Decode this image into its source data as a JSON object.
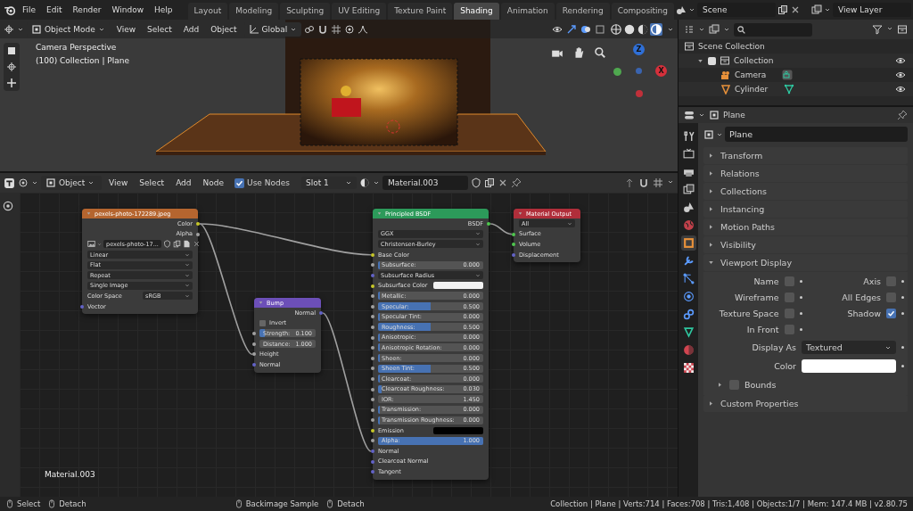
{
  "topbar": {
    "menus": [
      "File",
      "Edit",
      "Render",
      "Window",
      "Help"
    ],
    "workspaces": [
      {
        "label": "Layout",
        "selected": false
      },
      {
        "label": "Modeling",
        "selected": false
      },
      {
        "label": "Sculpting",
        "selected": false
      },
      {
        "label": "UV Editing",
        "selected": false
      },
      {
        "label": "Texture Paint",
        "selected": false
      },
      {
        "label": "Shading",
        "selected": true
      },
      {
        "label": "Animation",
        "selected": false
      },
      {
        "label": "Rendering",
        "selected": false
      },
      {
        "label": "Compositing",
        "selected": false
      }
    ],
    "scene": "Scene",
    "view_layer": "View Layer"
  },
  "viewport": {
    "mode": "Object Mode",
    "menus": [
      "View",
      "Select",
      "Add",
      "Object"
    ],
    "orientation": "Global",
    "shading": [
      {
        "kind": "wireframe",
        "selected": false
      },
      {
        "kind": "solid",
        "selected": false
      },
      {
        "kind": "material",
        "selected": false
      },
      {
        "kind": "rendered",
        "selected": true
      }
    ],
    "overlay": [
      "Camera Perspective",
      "(100) Collection | Plane"
    ],
    "axes": [
      {
        "label": "Z",
        "color": "#2f6fd6"
      },
      {
        "label": "X",
        "color": "#d6303b"
      }
    ]
  },
  "node_editor": {
    "type": "Object",
    "menus": [
      "View",
      "Select",
      "Add",
      "Node"
    ],
    "use_nodes": {
      "label": "Use Nodes",
      "checked": true
    },
    "slot": "Slot 1",
    "material": "Material.003",
    "nodes": [
      {
        "title": "pexels-photo-172289.jpeg",
        "color": "#b5652f",
        "rows": [
          {
            "kind": "output",
            "label": "Color",
            "color": "#c7c729",
            "linked": true
          },
          {
            "kind": "output",
            "label": "Alpha",
            "color": "#a1a1a1"
          },
          {
            "kind": "image",
            "value": "pexels-photo-17..."
          },
          {
            "kind": "dropdown",
            "value": "Linear"
          },
          {
            "kind": "dropdown",
            "value": "Flat"
          },
          {
            "kind": "dropdown",
            "value": "Repeat"
          },
          {
            "kind": "dropdown",
            "value": "Single Image"
          },
          {
            "kind": "labeled_dropdown",
            "label": "Color Space",
            "value": "sRGB"
          },
          {
            "kind": "input",
            "label": "Vector",
            "color": "#6363c7"
          }
        ]
      },
      {
        "title": "Bump",
        "color": "#6c4fb8",
        "rows": [
          {
            "kind": "output",
            "label": "Normal",
            "color": "#6363c7",
            "linked": true
          },
          {
            "kind": "checkbox",
            "label": "Invert",
            "checked": false
          },
          {
            "kind": "slider",
            "label": "Strength:",
            "value": "0.100",
            "level": 0.1,
            "color": "#a1a1a1"
          },
          {
            "kind": "number",
            "label": "Distance:",
            "value": "1.000",
            "color": "#a1a1a1"
          },
          {
            "kind": "input",
            "label": "Height",
            "color": "#a1a1a1",
            "linked": true
          },
          {
            "kind": "input",
            "label": "Normal",
            "color": "#6363c7"
          }
        ]
      },
      {
        "title": "Principled BSDF",
        "color": "#2c9a5a",
        "rows": [
          {
            "kind": "output",
            "label": "BSDF",
            "color": "#4fc74f",
            "linked": true
          },
          {
            "kind": "dropdown",
            "value": "GGX"
          },
          {
            "kind": "dropdown",
            "value": "Christensen-Burley"
          },
          {
            "kind": "input",
            "label": "Base Color",
            "color": "#c7c729",
            "linked": true
          },
          {
            "kind": "slider",
            "label": "Subsurface:",
            "value": "0.000",
            "level": 0,
            "color": "#a1a1a1"
          },
          {
            "kind": "dropdown",
            "value": "Subsurface Radius",
            "color": "#6363c7"
          },
          {
            "kind": "swatch",
            "label": "Subsurface Color",
            "color": "#f2f2f2",
            "socket": {
              "color": "#c7c729"
            }
          },
          {
            "kind": "slider",
            "label": "Metallic:",
            "value": "0.000",
            "level": 0,
            "color": "#a1a1a1"
          },
          {
            "kind": "slider",
            "label": "Specular:",
            "value": "0.500",
            "level": 0.5,
            "color": "#a1a1a1"
          },
          {
            "kind": "slider",
            "label": "Specular Tint:",
            "value": "0.000",
            "level": 0,
            "color": "#a1a1a1"
          },
          {
            "kind": "slider",
            "label": "Roughness:",
            "value": "0.500",
            "level": 0.5,
            "color": "#a1a1a1"
          },
          {
            "kind": "slider",
            "label": "Anisotropic:",
            "value": "0.000",
            "level": 0,
            "color": "#a1a1a1"
          },
          {
            "kind": "slider",
            "label": "Anisotropic Rotation:",
            "value": "0.000",
            "level": 0,
            "color": "#a1a1a1"
          },
          {
            "kind": "slider",
            "label": "Sheen:",
            "value": "0.000",
            "level": 0,
            "color": "#a1a1a1"
          },
          {
            "kind": "slider",
            "label": "Sheen Tint:",
            "value": "0.500",
            "level": 0.5,
            "color": "#a1a1a1"
          },
          {
            "kind": "slider",
            "label": "Clearcoat:",
            "value": "0.000",
            "level": 0,
            "color": "#a1a1a1"
          },
          {
            "kind": "slider",
            "label": "Clearcoat Roughness:",
            "value": "0.030",
            "level": 0.03,
            "color": "#a1a1a1"
          },
          {
            "kind": "number",
            "label": "IOR:",
            "value": "1.450",
            "color": "#a1a1a1"
          },
          {
            "kind": "slider",
            "label": "Transmission:",
            "value": "0.000",
            "level": 0,
            "color": "#a1a1a1"
          },
          {
            "kind": "slider",
            "label": "Transmission Roughness:",
            "value": "0.000",
            "level": 0,
            "color": "#a1a1a1"
          },
          {
            "kind": "swatch",
            "label": "Emission",
            "color": "#000000",
            "socket": {
              "color": "#c7c729"
            }
          },
          {
            "kind": "slider",
            "label": "Alpha:",
            "value": "1.000",
            "level": 1,
            "color": "#a1a1a1"
          },
          {
            "kind": "input",
            "label": "Normal",
            "color": "#6363c7",
            "linked": true
          },
          {
            "kind": "input",
            "label": "Clearcoat Normal",
            "color": "#6363c7"
          },
          {
            "kind": "input",
            "label": "Tangent",
            "color": "#6363c7"
          }
        ]
      },
      {
        "title": "Material Output",
        "color": "#b02e3a",
        "rows": [
          {
            "kind": "dropdown",
            "value": "All"
          },
          {
            "kind": "input",
            "label": "Surface",
            "color": "#4fc74f",
            "linked": true
          },
          {
            "kind": "input",
            "label": "Volume",
            "color": "#4fc74f"
          },
          {
            "kind": "input",
            "label": "Displacement",
            "color": "#6363c7"
          }
        ]
      }
    ],
    "material_label": "Material.003"
  },
  "outliner": {
    "items": [
      {
        "kind": "scene_collection",
        "label": "Scene Collection",
        "children": [
          {
            "kind": "collection",
            "label": "Collection",
            "checked": true,
            "expanded": true,
            "visible": true,
            "children": [
              {
                "kind": "camera",
                "label": "Camera",
                "visible": true
              },
              {
                "kind": "mesh",
                "label": "Cylinder",
                "visible": true
              }
            ]
          }
        ]
      }
    ]
  },
  "properties": {
    "object": "Plane",
    "name_field": "Plane",
    "tabs": [
      {
        "kind": "tool",
        "selected": false
      },
      {
        "kind": "render",
        "selected": false
      },
      {
        "kind": "output",
        "selected": false
      },
      {
        "kind": "view_layer",
        "selected": false
      },
      {
        "kind": "scene",
        "selected": false
      },
      {
        "kind": "world",
        "selected": false
      },
      {
        "kind": "object",
        "selected": true
      },
      {
        "kind": "modifier",
        "selected": false
      },
      {
        "kind": "particles",
        "selected": false
      },
      {
        "kind": "physics",
        "selected": false
      },
      {
        "kind": "constraints",
        "selected": false
      },
      {
        "kind": "data",
        "selected": false
      },
      {
        "kind": "material",
        "selected": false
      },
      {
        "kind": "texture",
        "selected": false
      }
    ],
    "panels": [
      {
        "label": "Transform",
        "expanded": false
      },
      {
        "label": "Relations",
        "expanded": false
      },
      {
        "label": "Collections",
        "expanded": false
      },
      {
        "label": "Instancing",
        "expanded": false
      },
      {
        "label": "Motion Paths",
        "expanded": false
      },
      {
        "label": "Visibility",
        "expanded": false
      },
      {
        "label": "Viewport Display",
        "expanded": true
      }
    ],
    "viewport_display": {
      "checks": [
        {
          "label": "Name",
          "checked": false
        },
        {
          "label": "Axis",
          "checked": false
        },
        {
          "label": "Wireframe",
          "checked": false
        },
        {
          "label": "All Edges",
          "checked": false
        },
        {
          "label": "Texture Space",
          "checked": false
        },
        {
          "label": "Shadow",
          "checked": true
        },
        {
          "label": "In Front",
          "checked": false
        }
      ],
      "display_as_label": "Display As",
      "display_as": "Textured",
      "color_label": "Color",
      "color": "#ffffff",
      "bounds": {
        "label": "Bounds",
        "checked": false,
        "expanded": false
      }
    },
    "custom": {
      "label": "Custom Properties",
      "expanded": false
    }
  },
  "status_bar": {
    "items": [
      {
        "label": "Select"
      },
      {
        "label": "Detach"
      }
    ],
    "items_2": [
      {
        "label": "Backimage Sample"
      },
      {
        "label": "Detach"
      }
    ],
    "info": "Collection | Plane | Verts:714 | Faces:708 | Tris:1,408 | Objects:1/7 | Mem: 147.4 MB | v2.80.75"
  }
}
